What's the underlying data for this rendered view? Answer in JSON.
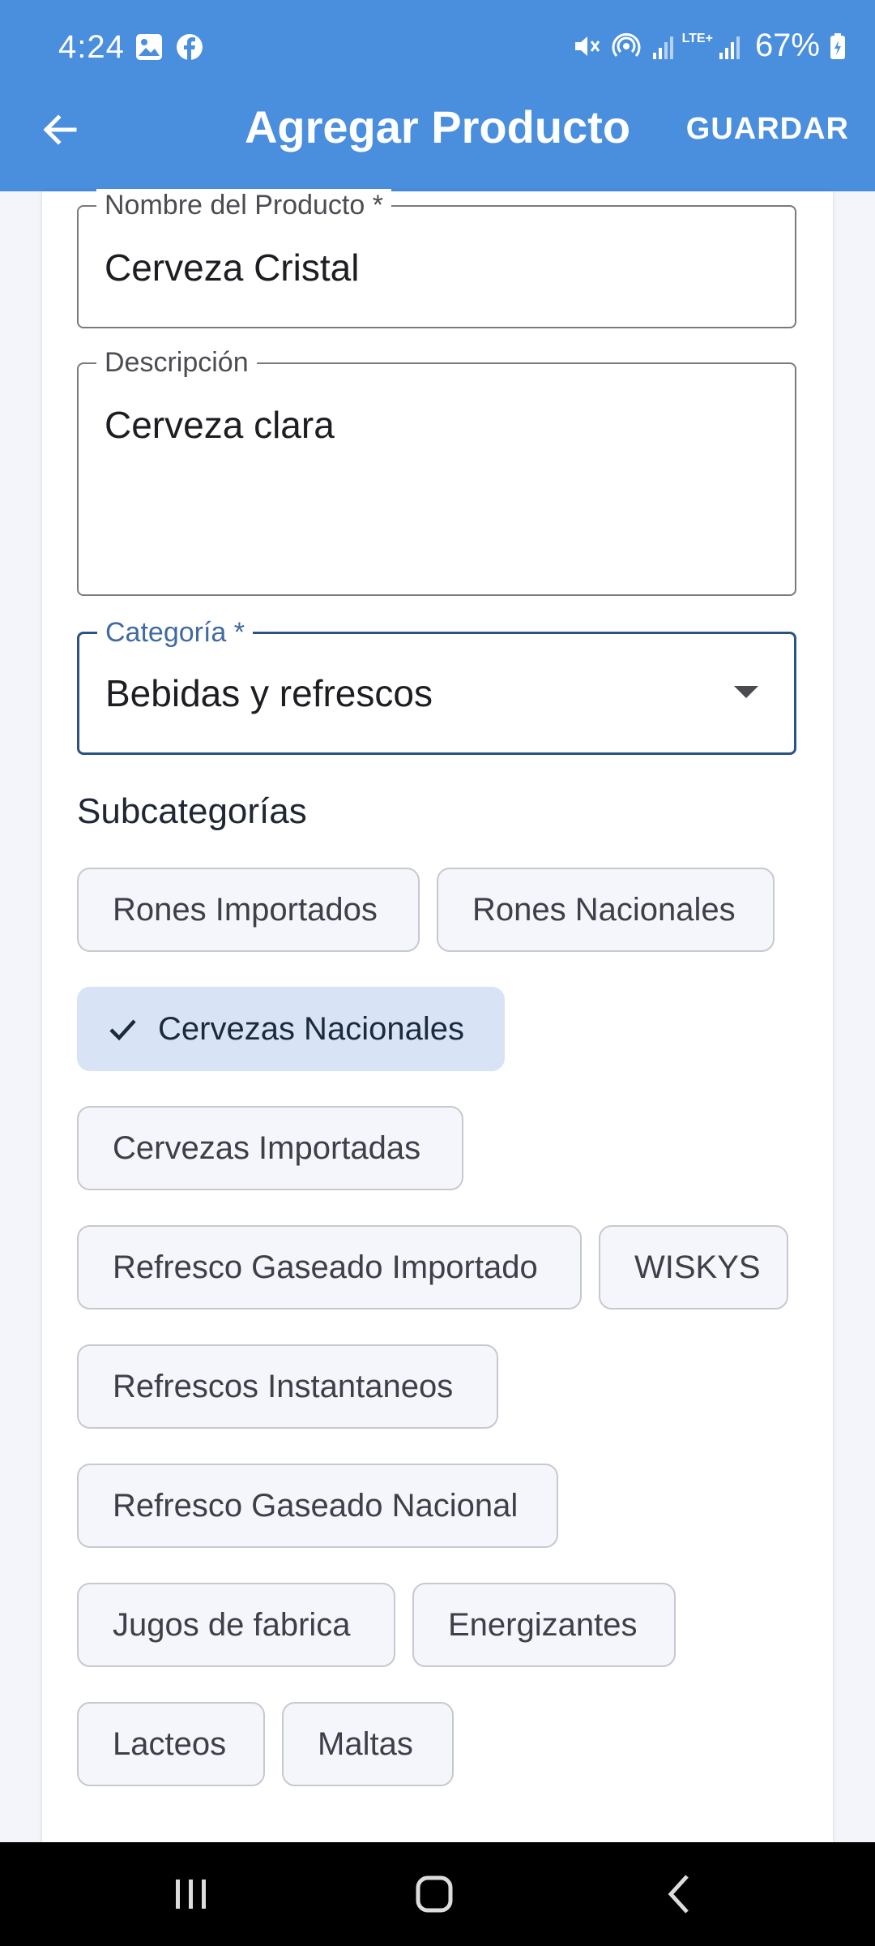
{
  "status_bar": {
    "time": "4:24",
    "battery": "67%",
    "network_tag": "LTE+",
    "icons": [
      "image-icon",
      "facebook-icon",
      "mute-icon",
      "hotspot-icon",
      "signal-icon",
      "signal-icon",
      "battery-icon"
    ]
  },
  "app_bar": {
    "title": "Agregar Producto",
    "save_label": "GUARDAR",
    "back_icon": "arrow-left-icon"
  },
  "form": {
    "name": {
      "label": "Nombre del Producto *",
      "value": "Cerveza Cristal"
    },
    "description": {
      "label": "Descripción",
      "value": "Cerveza clara"
    },
    "category": {
      "label": "Categoría *",
      "value": "Bebidas y refrescos"
    }
  },
  "subcategories": {
    "title": "Subcategorías",
    "chips": [
      {
        "label": "Rones Importados",
        "selected": false
      },
      {
        "label": "Rones Nacionales",
        "selected": false
      },
      {
        "label": "Cervezas Nacionales",
        "selected": true
      },
      {
        "label": "Cervezas Importadas",
        "selected": false
      },
      {
        "label": "Refresco Gaseado Importado",
        "selected": false
      },
      {
        "label": "WISKYS",
        "selected": false
      },
      {
        "label": "Refrescos Instantaneos",
        "selected": false
      },
      {
        "label": "Refresco Gaseado Nacional",
        "selected": false
      },
      {
        "label": "Jugos de fabrica",
        "selected": false
      },
      {
        "label": "Energizantes",
        "selected": false
      },
      {
        "label": "Lacteos",
        "selected": false
      },
      {
        "label": "Maltas",
        "selected": false
      }
    ]
  },
  "colors": {
    "app_bar": "#4a8ede",
    "selected_chip": "#d8e3f6",
    "focus_border": "#2c5282"
  }
}
